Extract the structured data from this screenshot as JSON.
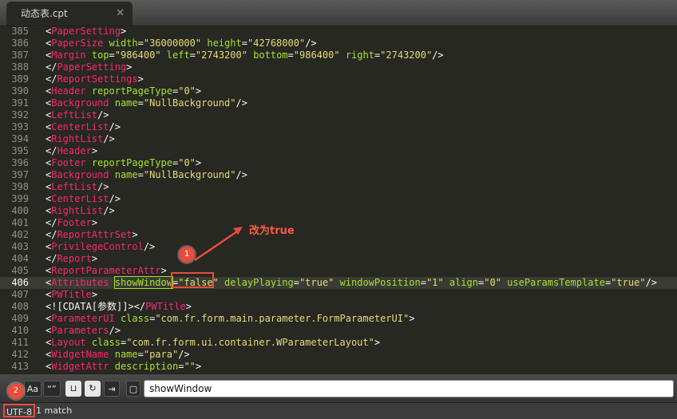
{
  "tab": {
    "title": "动态表.cpt"
  },
  "annotation": {
    "text": "改为true",
    "badge1": "1",
    "badge2": "2"
  },
  "code_lines": [
    {
      "n": "385",
      "parts": [
        [
          "p",
          "<"
        ],
        [
          "t",
          "PaperSetting"
        ],
        [
          "p",
          ">"
        ]
      ]
    },
    {
      "n": "386",
      "parts": [
        [
          "p",
          "<"
        ],
        [
          "t",
          "PaperSize"
        ],
        [
          "p",
          " "
        ],
        [
          "a",
          "width"
        ],
        [
          "p",
          "="
        ],
        [
          "s",
          "\"36000000\""
        ],
        [
          "p",
          " "
        ],
        [
          "a",
          "height"
        ],
        [
          "p",
          "="
        ],
        [
          "s",
          "\"42768000\""
        ],
        [
          "p",
          "/>"
        ]
      ]
    },
    {
      "n": "387",
      "parts": [
        [
          "p",
          "<"
        ],
        [
          "t",
          "Margin"
        ],
        [
          "p",
          " "
        ],
        [
          "a",
          "top"
        ],
        [
          "p",
          "="
        ],
        [
          "s",
          "\"986400\""
        ],
        [
          "p",
          " "
        ],
        [
          "a",
          "left"
        ],
        [
          "p",
          "="
        ],
        [
          "s",
          "\"2743200\""
        ],
        [
          "p",
          " "
        ],
        [
          "a",
          "bottom"
        ],
        [
          "p",
          "="
        ],
        [
          "s",
          "\"986400\""
        ],
        [
          "p",
          " "
        ],
        [
          "a",
          "right"
        ],
        [
          "p",
          "="
        ],
        [
          "s",
          "\"2743200\""
        ],
        [
          "p",
          "/>"
        ]
      ]
    },
    {
      "n": "388",
      "parts": [
        [
          "p",
          "</"
        ],
        [
          "t",
          "PaperSetting"
        ],
        [
          "p",
          ">"
        ]
      ]
    },
    {
      "n": "389",
      "parts": [
        [
          "p",
          "</"
        ],
        [
          "t",
          "ReportSettings"
        ],
        [
          "p",
          ">"
        ]
      ]
    },
    {
      "n": "390",
      "parts": [
        [
          "p",
          "<"
        ],
        [
          "t",
          "Header"
        ],
        [
          "p",
          " "
        ],
        [
          "a",
          "reportPageType"
        ],
        [
          "p",
          "="
        ],
        [
          "s",
          "\"0\""
        ],
        [
          "p",
          ">"
        ]
      ]
    },
    {
      "n": "391",
      "parts": [
        [
          "p",
          "<"
        ],
        [
          "t",
          "Background"
        ],
        [
          "p",
          " "
        ],
        [
          "a",
          "name"
        ],
        [
          "p",
          "="
        ],
        [
          "s",
          "\"NullBackground\""
        ],
        [
          "p",
          "/>"
        ]
      ]
    },
    {
      "n": "392",
      "parts": [
        [
          "p",
          "<"
        ],
        [
          "t",
          "LeftList"
        ],
        [
          "p",
          "/>"
        ]
      ]
    },
    {
      "n": "393",
      "parts": [
        [
          "p",
          "<"
        ],
        [
          "t",
          "CenterList"
        ],
        [
          "p",
          "/>"
        ]
      ]
    },
    {
      "n": "394",
      "parts": [
        [
          "p",
          "<"
        ],
        [
          "t",
          "RightList"
        ],
        [
          "p",
          "/>"
        ]
      ]
    },
    {
      "n": "395",
      "parts": [
        [
          "p",
          "</"
        ],
        [
          "t",
          "Header"
        ],
        [
          "p",
          ">"
        ]
      ]
    },
    {
      "n": "396",
      "parts": [
        [
          "p",
          "<"
        ],
        [
          "t",
          "Footer"
        ],
        [
          "p",
          " "
        ],
        [
          "a",
          "reportPageType"
        ],
        [
          "p",
          "="
        ],
        [
          "s",
          "\"0\""
        ],
        [
          "p",
          ">"
        ]
      ]
    },
    {
      "n": "397",
      "parts": [
        [
          "p",
          "<"
        ],
        [
          "t",
          "Background"
        ],
        [
          "p",
          " "
        ],
        [
          "a",
          "name"
        ],
        [
          "p",
          "="
        ],
        [
          "s",
          "\"NullBackground\""
        ],
        [
          "p",
          "/>"
        ]
      ]
    },
    {
      "n": "398",
      "parts": [
        [
          "p",
          "<"
        ],
        [
          "t",
          "LeftList"
        ],
        [
          "p",
          "/>"
        ]
      ]
    },
    {
      "n": "399",
      "parts": [
        [
          "p",
          "<"
        ],
        [
          "t",
          "CenterList"
        ],
        [
          "p",
          "/>"
        ]
      ]
    },
    {
      "n": "400",
      "parts": [
        [
          "p",
          "<"
        ],
        [
          "t",
          "RightList"
        ],
        [
          "p",
          "/>"
        ]
      ]
    },
    {
      "n": "401",
      "parts": [
        [
          "p",
          "</"
        ],
        [
          "t",
          "Footer"
        ],
        [
          "p",
          ">"
        ]
      ]
    },
    {
      "n": "402",
      "parts": [
        [
          "p",
          "</"
        ],
        [
          "t",
          "ReportAttrSet"
        ],
        [
          "p",
          ">"
        ]
      ]
    },
    {
      "n": "403",
      "parts": [
        [
          "p",
          "<"
        ],
        [
          "t",
          "PrivilegeControl"
        ],
        [
          "p",
          "/>"
        ]
      ]
    },
    {
      "n": "404",
      "parts": [
        [
          "p",
          "</"
        ],
        [
          "t",
          "Report"
        ],
        [
          "p",
          ">"
        ]
      ]
    },
    {
      "n": "405",
      "parts": [
        [
          "p",
          "<"
        ],
        [
          "t",
          "ReportParameterAttr"
        ],
        [
          "p",
          ">"
        ]
      ]
    },
    {
      "n": "406",
      "current": true,
      "parts": [
        [
          "p",
          "<"
        ],
        [
          "t",
          "Attributes"
        ],
        [
          "p",
          " "
        ],
        [
          "a hl",
          "showWindow"
        ],
        [
          "p",
          "="
        ],
        [
          "s",
          "\"false\""
        ],
        [
          "p",
          " "
        ],
        [
          "a",
          "delayPlaying"
        ],
        [
          "p",
          "="
        ],
        [
          "s",
          "\"true\""
        ],
        [
          "p",
          " "
        ],
        [
          "a",
          "windowPosition"
        ],
        [
          "p",
          "="
        ],
        [
          "s",
          "\"1\""
        ],
        [
          "p",
          " "
        ],
        [
          "a",
          "align"
        ],
        [
          "p",
          "="
        ],
        [
          "s",
          "\"0\""
        ],
        [
          "p",
          " "
        ],
        [
          "a",
          "useParamsTemplate"
        ],
        [
          "p",
          "="
        ],
        [
          "s",
          "\"true\""
        ],
        [
          "p",
          "/>"
        ]
      ]
    },
    {
      "n": "407",
      "parts": [
        [
          "p",
          "<"
        ],
        [
          "t",
          "PWTitle"
        ],
        [
          "p",
          ">"
        ]
      ]
    },
    {
      "n": "408",
      "parts": [
        [
          "p",
          "<![CDATA[参数]]></"
        ],
        [
          "t",
          "PWTitle"
        ],
        [
          "p",
          ">"
        ]
      ]
    },
    {
      "n": "409",
      "parts": [
        [
          "p",
          "<"
        ],
        [
          "t",
          "ParameterUI"
        ],
        [
          "p",
          " "
        ],
        [
          "a",
          "class"
        ],
        [
          "p",
          "="
        ],
        [
          "s",
          "\"com.fr.form.main.parameter.FormParameterUI\""
        ],
        [
          "p",
          ">"
        ]
      ]
    },
    {
      "n": "410",
      "parts": [
        [
          "p",
          "<"
        ],
        [
          "t",
          "Parameters"
        ],
        [
          "p",
          "/>"
        ]
      ]
    },
    {
      "n": "411",
      "parts": [
        [
          "p",
          "<"
        ],
        [
          "t",
          "Layout"
        ],
        [
          "p",
          " "
        ],
        [
          "a",
          "class"
        ],
        [
          "p",
          "="
        ],
        [
          "s",
          "\"com.fr.form.ui.container.WParameterLayout\""
        ],
        [
          "p",
          ">"
        ]
      ]
    },
    {
      "n": "412",
      "parts": [
        [
          "p",
          "<"
        ],
        [
          "t",
          "WidgetName"
        ],
        [
          "p",
          " "
        ],
        [
          "a",
          "name"
        ],
        [
          "p",
          "="
        ],
        [
          "s",
          "\"para\""
        ],
        [
          "p",
          "/>"
        ]
      ]
    },
    {
      "n": "413",
      "parts": [
        [
          "p",
          "<"
        ],
        [
          "t",
          "WidgetAttr"
        ],
        [
          "p",
          " "
        ],
        [
          "a",
          "description"
        ],
        [
          "p",
          "="
        ],
        [
          "s",
          "\"\""
        ],
        [
          "p",
          ">"
        ]
      ]
    },
    {
      "n": "414",
      "parts": [
        [
          "p",
          "<"
        ],
        [
          "t",
          "PrivilegeControl"
        ],
        [
          "p",
          "/>"
        ]
      ]
    }
  ],
  "findbar": {
    "btn_regex": ".*",
    "btn_case": "Aa",
    "btn_word": "“”",
    "btn_wrap": "⊔",
    "btn_inselection": "↻",
    "btn_highlight": "⇥",
    "btn_context": "▢",
    "query": "showWindow"
  },
  "status": {
    "encoding": "UTF-8",
    "matches": "1 match"
  },
  "colors": {
    "tag": "#f92672",
    "attr": "#a6e22e",
    "string": "#e6db74",
    "text": "#f8f8f2",
    "background": "#272822",
    "annotation": "#e94b3c"
  }
}
